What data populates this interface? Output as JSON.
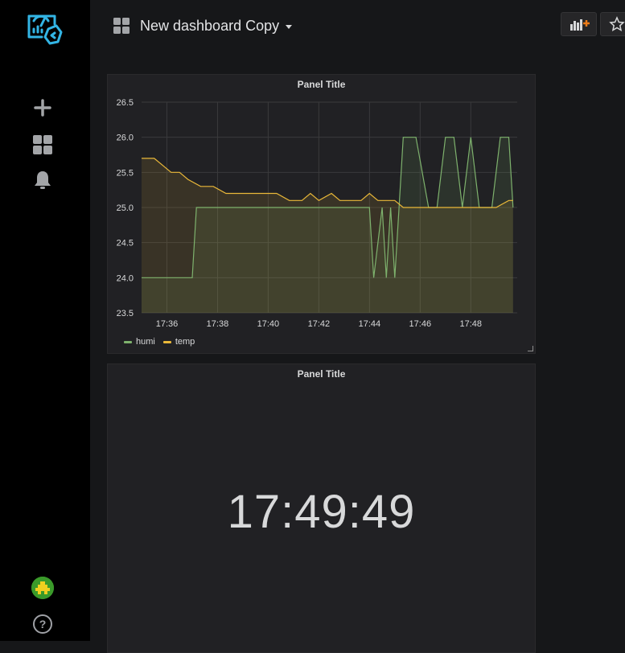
{
  "header": {
    "dashboard_title": "New dashboard Copy"
  },
  "sidebar": {
    "items": [
      {
        "name": "create",
        "icon": "plus-icon"
      },
      {
        "name": "dashboards",
        "icon": "grid-icon"
      },
      {
        "name": "alerting",
        "icon": "bell-icon"
      }
    ],
    "help_label": "?"
  },
  "colors": {
    "humi": "#7eb26d",
    "temp": "#eab839",
    "accent": "#33b5e5"
  },
  "panels": [
    {
      "title": "Panel Title"
    },
    {
      "title": "Panel Title",
      "clock_value": "17:49:49"
    }
  ],
  "chart_data": {
    "type": "line",
    "title": "Panel Title",
    "xlabel": "",
    "ylabel": "",
    "x_ticks": [
      "17:36",
      "17:38",
      "17:40",
      "17:42",
      "17:44",
      "17:46",
      "17:48"
    ],
    "y_ticks": [
      "23.5",
      "24.0",
      "24.5",
      "25.0",
      "25.5",
      "26.0",
      "26.5"
    ],
    "ylim": [
      23.5,
      26.5
    ],
    "xlim": [
      "17:35:00",
      "17:49:50"
    ],
    "grid": true,
    "legend": "bottom-left",
    "series": [
      {
        "name": "humi",
        "color": "#7eb26d",
        "x": [
          "17:35:00",
          "17:37:00",
          "17:37:10",
          "17:44:00",
          "17:44:10",
          "17:44:30",
          "17:44:40",
          "17:44:50",
          "17:45:00",
          "17:45:10",
          "17:45:20",
          "17:45:50",
          "17:46:20",
          "17:46:40",
          "17:47:00",
          "17:47:20",
          "17:47:40",
          "17:48:00",
          "17:48:20",
          "17:48:50",
          "17:49:10",
          "17:49:30",
          "17:49:40"
        ],
        "values": [
          24.0,
          24.0,
          25.0,
          25.0,
          24.0,
          25.0,
          24.0,
          25.0,
          24.0,
          25.0,
          26.0,
          26.0,
          25.0,
          25.0,
          26.0,
          26.0,
          25.0,
          26.0,
          25.0,
          25.0,
          26.0,
          26.0,
          25.0
        ]
      },
      {
        "name": "temp",
        "color": "#eab839",
        "x": [
          "17:35:00",
          "17:35:30",
          "17:35:50",
          "17:36:10",
          "17:36:30",
          "17:36:50",
          "17:37:20",
          "17:37:50",
          "17:38:20",
          "17:38:50",
          "17:39:20",
          "17:39:50",
          "17:40:20",
          "17:40:50",
          "17:41:20",
          "17:41:40",
          "17:42:00",
          "17:42:30",
          "17:42:50",
          "17:43:10",
          "17:43:40",
          "17:44:00",
          "17:44:20",
          "17:44:40",
          "17:45:00",
          "17:45:20",
          "17:45:40",
          "17:46:00",
          "17:46:30",
          "17:47:00",
          "17:47:30",
          "17:48:00",
          "17:48:30",
          "17:49:00",
          "17:49:30",
          "17:49:40"
        ],
        "values": [
          25.7,
          25.7,
          25.6,
          25.5,
          25.5,
          25.4,
          25.3,
          25.3,
          25.2,
          25.2,
          25.2,
          25.2,
          25.2,
          25.1,
          25.1,
          25.2,
          25.1,
          25.2,
          25.1,
          25.1,
          25.1,
          25.2,
          25.1,
          25.1,
          25.1,
          25.0,
          25.0,
          25.0,
          25.0,
          25.0,
          25.0,
          25.0,
          25.0,
          25.0,
          25.1,
          25.1
        ]
      }
    ]
  }
}
